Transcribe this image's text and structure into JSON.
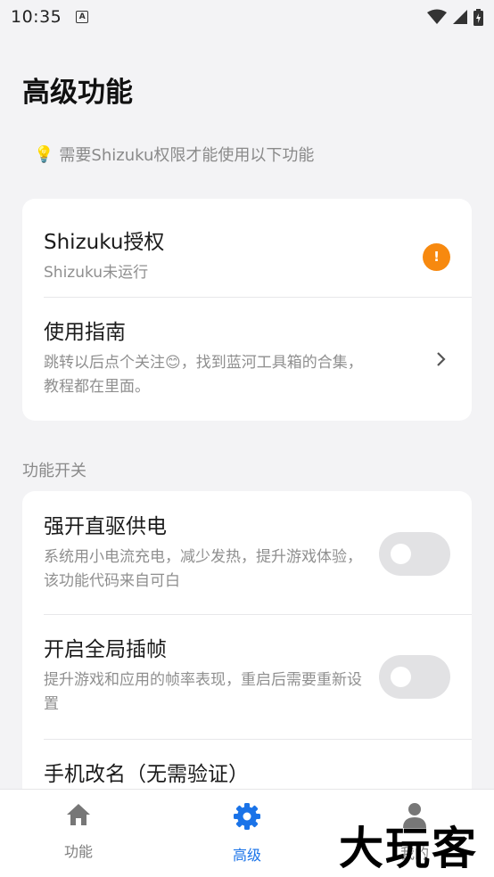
{
  "status": {
    "time": "10:35",
    "notif_letter": "A"
  },
  "page": {
    "title": "高级功能",
    "hint": "需要Shizuku权限才能使用以下功能"
  },
  "auth_card": {
    "shizuku": {
      "title": "Shizuku授权",
      "subtitle": "Shizuku未运行",
      "badge": "!"
    },
    "guide": {
      "title": "使用指南",
      "subtitle": "跳转以后点个关注😊，找到蓝河工具箱的合集，教程都在里面。"
    }
  },
  "features": {
    "section_label": "功能开关",
    "items": [
      {
        "title": "强开直驱供电",
        "subtitle": "系统用小电流充电，减少发热，提升游戏体验，该功能代码来自可白",
        "enabled": false
      },
      {
        "title": "开启全局插帧",
        "subtitle": "提升游戏和应用的帧率表现，重启后需要重新设置",
        "enabled": false
      },
      {
        "title": "手机改名（无需验证）"
      }
    ]
  },
  "nav": {
    "items": [
      {
        "label": "功能",
        "icon": "home-icon",
        "active": false
      },
      {
        "label": "高级",
        "icon": "gear-icon",
        "active": true
      },
      {
        "label": "我的",
        "icon": "person-icon",
        "active": false
      }
    ]
  },
  "watermark": "大玩客",
  "colors": {
    "accent": "#1a73e8",
    "warning": "#f7890f",
    "toggle_off": "#e2e2e4"
  }
}
